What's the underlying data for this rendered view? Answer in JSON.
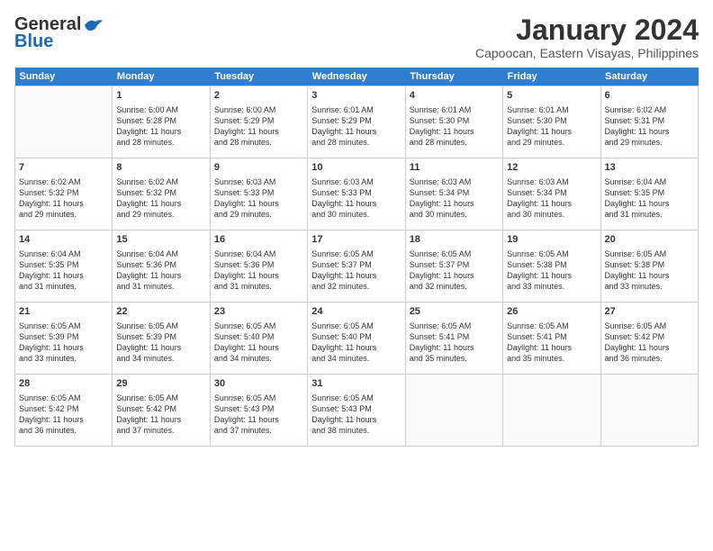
{
  "header": {
    "logo_line1": "General",
    "logo_line2": "Blue",
    "month": "January 2024",
    "location": "Capoocan, Eastern Visayas, Philippines"
  },
  "weekdays": [
    "Sunday",
    "Monday",
    "Tuesday",
    "Wednesday",
    "Thursday",
    "Friday",
    "Saturday"
  ],
  "weeks": [
    [
      {
        "day": "",
        "info": ""
      },
      {
        "day": "1",
        "info": "Sunrise: 6:00 AM\nSunset: 5:28 PM\nDaylight: 11 hours\nand 28 minutes."
      },
      {
        "day": "2",
        "info": "Sunrise: 6:00 AM\nSunset: 5:29 PM\nDaylight: 11 hours\nand 28 minutes."
      },
      {
        "day": "3",
        "info": "Sunrise: 6:01 AM\nSunset: 5:29 PM\nDaylight: 11 hours\nand 28 minutes."
      },
      {
        "day": "4",
        "info": "Sunrise: 6:01 AM\nSunset: 5:30 PM\nDaylight: 11 hours\nand 28 minutes."
      },
      {
        "day": "5",
        "info": "Sunrise: 6:01 AM\nSunset: 5:30 PM\nDaylight: 11 hours\nand 29 minutes."
      },
      {
        "day": "6",
        "info": "Sunrise: 6:02 AM\nSunset: 5:31 PM\nDaylight: 11 hours\nand 29 minutes."
      }
    ],
    [
      {
        "day": "7",
        "info": "Sunrise: 6:02 AM\nSunset: 5:32 PM\nDaylight: 11 hours\nand 29 minutes."
      },
      {
        "day": "8",
        "info": "Sunrise: 6:02 AM\nSunset: 5:32 PM\nDaylight: 11 hours\nand 29 minutes."
      },
      {
        "day": "9",
        "info": "Sunrise: 6:03 AM\nSunset: 5:33 PM\nDaylight: 11 hours\nand 29 minutes."
      },
      {
        "day": "10",
        "info": "Sunrise: 6:03 AM\nSunset: 5:33 PM\nDaylight: 11 hours\nand 30 minutes."
      },
      {
        "day": "11",
        "info": "Sunrise: 6:03 AM\nSunset: 5:34 PM\nDaylight: 11 hours\nand 30 minutes."
      },
      {
        "day": "12",
        "info": "Sunrise: 6:03 AM\nSunset: 5:34 PM\nDaylight: 11 hours\nand 30 minutes."
      },
      {
        "day": "13",
        "info": "Sunrise: 6:04 AM\nSunset: 5:35 PM\nDaylight: 11 hours\nand 31 minutes."
      }
    ],
    [
      {
        "day": "14",
        "info": "Sunrise: 6:04 AM\nSunset: 5:35 PM\nDaylight: 11 hours\nand 31 minutes."
      },
      {
        "day": "15",
        "info": "Sunrise: 6:04 AM\nSunset: 5:36 PM\nDaylight: 11 hours\nand 31 minutes."
      },
      {
        "day": "16",
        "info": "Sunrise: 6:04 AM\nSunset: 5:36 PM\nDaylight: 11 hours\nand 31 minutes."
      },
      {
        "day": "17",
        "info": "Sunrise: 6:05 AM\nSunset: 5:37 PM\nDaylight: 11 hours\nand 32 minutes."
      },
      {
        "day": "18",
        "info": "Sunrise: 6:05 AM\nSunset: 5:37 PM\nDaylight: 11 hours\nand 32 minutes."
      },
      {
        "day": "19",
        "info": "Sunrise: 6:05 AM\nSunset: 5:38 PM\nDaylight: 11 hours\nand 33 minutes."
      },
      {
        "day": "20",
        "info": "Sunrise: 6:05 AM\nSunset: 5:38 PM\nDaylight: 11 hours\nand 33 minutes."
      }
    ],
    [
      {
        "day": "21",
        "info": "Sunrise: 6:05 AM\nSunset: 5:39 PM\nDaylight: 11 hours\nand 33 minutes."
      },
      {
        "day": "22",
        "info": "Sunrise: 6:05 AM\nSunset: 5:39 PM\nDaylight: 11 hours\nand 34 minutes."
      },
      {
        "day": "23",
        "info": "Sunrise: 6:05 AM\nSunset: 5:40 PM\nDaylight: 11 hours\nand 34 minutes."
      },
      {
        "day": "24",
        "info": "Sunrise: 6:05 AM\nSunset: 5:40 PM\nDaylight: 11 hours\nand 34 minutes."
      },
      {
        "day": "25",
        "info": "Sunrise: 6:05 AM\nSunset: 5:41 PM\nDaylight: 11 hours\nand 35 minutes."
      },
      {
        "day": "26",
        "info": "Sunrise: 6:05 AM\nSunset: 5:41 PM\nDaylight: 11 hours\nand 35 minutes."
      },
      {
        "day": "27",
        "info": "Sunrise: 6:05 AM\nSunset: 5:42 PM\nDaylight: 11 hours\nand 36 minutes."
      }
    ],
    [
      {
        "day": "28",
        "info": "Sunrise: 6:05 AM\nSunset: 5:42 PM\nDaylight: 11 hours\nand 36 minutes."
      },
      {
        "day": "29",
        "info": "Sunrise: 6:05 AM\nSunset: 5:42 PM\nDaylight: 11 hours\nand 37 minutes."
      },
      {
        "day": "30",
        "info": "Sunrise: 6:05 AM\nSunset: 5:43 PM\nDaylight: 11 hours\nand 37 minutes."
      },
      {
        "day": "31",
        "info": "Sunrise: 6:05 AM\nSunset: 5:43 PM\nDaylight: 11 hours\nand 38 minutes."
      },
      {
        "day": "",
        "info": ""
      },
      {
        "day": "",
        "info": ""
      },
      {
        "day": "",
        "info": ""
      }
    ]
  ]
}
